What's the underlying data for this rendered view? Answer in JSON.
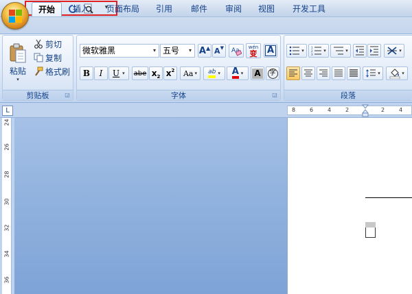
{
  "quick_access": {
    "items": [
      "save-icon",
      "undo-icon",
      "redo-icon",
      "print-preview-icon"
    ],
    "more_symbol": "▾"
  },
  "tabs": [
    "开始",
    "插入",
    "页面布局",
    "引用",
    "邮件",
    "审阅",
    "视图",
    "开发工具"
  ],
  "active_tab": 0,
  "clipboard": {
    "paste_label": "粘贴",
    "cut_label": "剪切",
    "copy_label": "复制",
    "format_painter_label": "格式刷",
    "group_label": "剪贴板"
  },
  "font": {
    "font_name": "微软雅黑",
    "font_size": "五号",
    "grow_label": "A",
    "shrink_label": "A",
    "phonetic_label": "wén",
    "phonetic_char": "变",
    "border_label": "A",
    "bold": "B",
    "italic": "I",
    "underline": "U",
    "strike": "abe",
    "subscript": "x",
    "subscript_mark": "2",
    "superscript": "x",
    "superscript_mark": "2",
    "case": "Aa",
    "highlight": "ab",
    "font_color": "A",
    "shading": "A",
    "enclose": "字",
    "group_label": "字体"
  },
  "paragraph": {
    "group_label": "段落"
  },
  "ruler": {
    "top_numbers": [
      "8",
      "6",
      "4",
      "2",
      "2",
      "4"
    ],
    "left_numbers": [
      "24",
      "26",
      "28",
      "30",
      "32",
      "34",
      "36"
    ],
    "corner_symbol": "L"
  },
  "colors": {
    "highlight": "#ffff00",
    "font_color": "#e00000",
    "qat_highlight_border": "#e02020"
  }
}
